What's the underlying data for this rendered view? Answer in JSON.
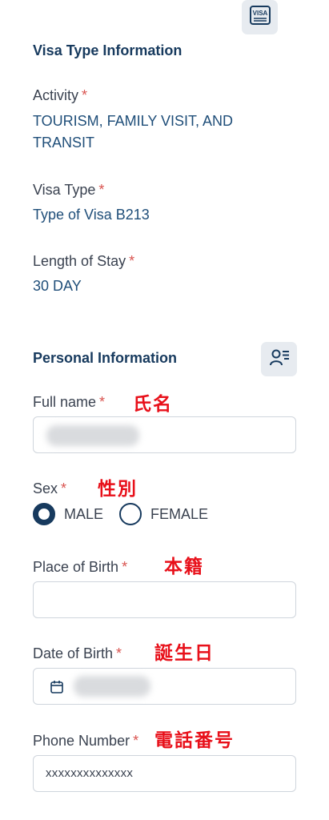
{
  "top_icon": {
    "text": "VISA",
    "icon": "visa-card-icon"
  },
  "visa_section": {
    "title": "Visa Type Information",
    "activity": {
      "label": "Activity",
      "required": "*",
      "value_line1": "TOURISM, FAMILY VISIT, AND",
      "value_line2": "TRANSIT"
    },
    "visa_type": {
      "label": "Visa Type",
      "required": "*",
      "value": "Type of Visa B213"
    },
    "length_of_stay": {
      "label": "Length of Stay",
      "required": "*",
      "value": "30 DAY"
    }
  },
  "personal_section": {
    "title": "Personal Information",
    "icon": "person-list-icon",
    "full_name": {
      "label": "Full name",
      "required": "*",
      "annotation": "氏名"
    },
    "sex": {
      "label": "Sex",
      "required": "*",
      "annotation": "性別",
      "options": [
        "MALE",
        "FEMALE"
      ],
      "selected": "MALE"
    },
    "place_of_birth": {
      "label": "Place of Birth",
      "required": "*",
      "annotation": "本籍",
      "value": ""
    },
    "date_of_birth": {
      "label": "Date of Birth",
      "required": "*",
      "annotation": "誕生日",
      "icon": "calendar-icon"
    },
    "phone": {
      "label": "Phone Number",
      "required": "*",
      "annotation": "電話番号",
      "value": "xxxxxxxxxxxxxx"
    }
  },
  "colors": {
    "navy": "#173a5e",
    "value_blue": "#1f4e79",
    "required_red": "#d9534f",
    "annotation_red": "#e8101a"
  }
}
